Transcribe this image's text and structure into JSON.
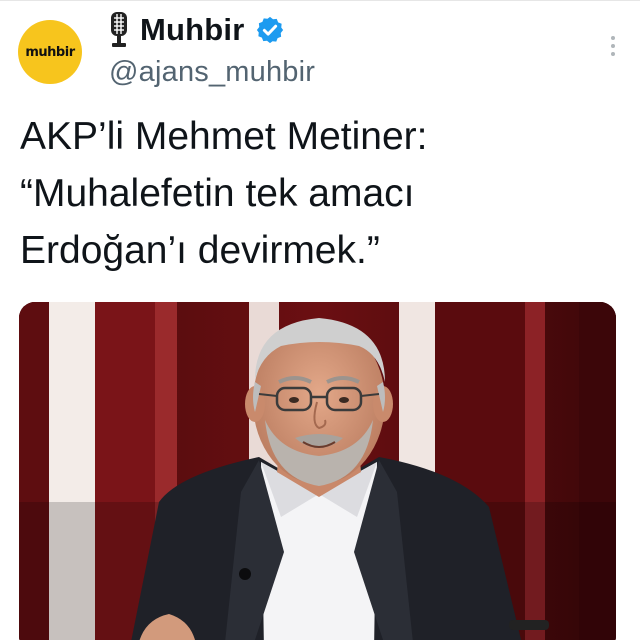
{
  "account": {
    "display_name": "Muhbir",
    "handle": "@ajans_muhbir",
    "avatar_text": "muhbir",
    "verified": true,
    "icons": [
      "microphone-icon",
      "verified-badge-icon",
      "more-options-icon"
    ]
  },
  "tweet": {
    "lines": [
      "AKP’li Mehmet Metiner:",
      "“Muhalefetin tek amacı",
      "Erdoğan’ı devirmek.”"
    ]
  },
  "colors": {
    "avatar_bg": "#f7c51d",
    "verified": "#1d9bf0",
    "text": "#0f1419",
    "handle": "#536471"
  }
}
